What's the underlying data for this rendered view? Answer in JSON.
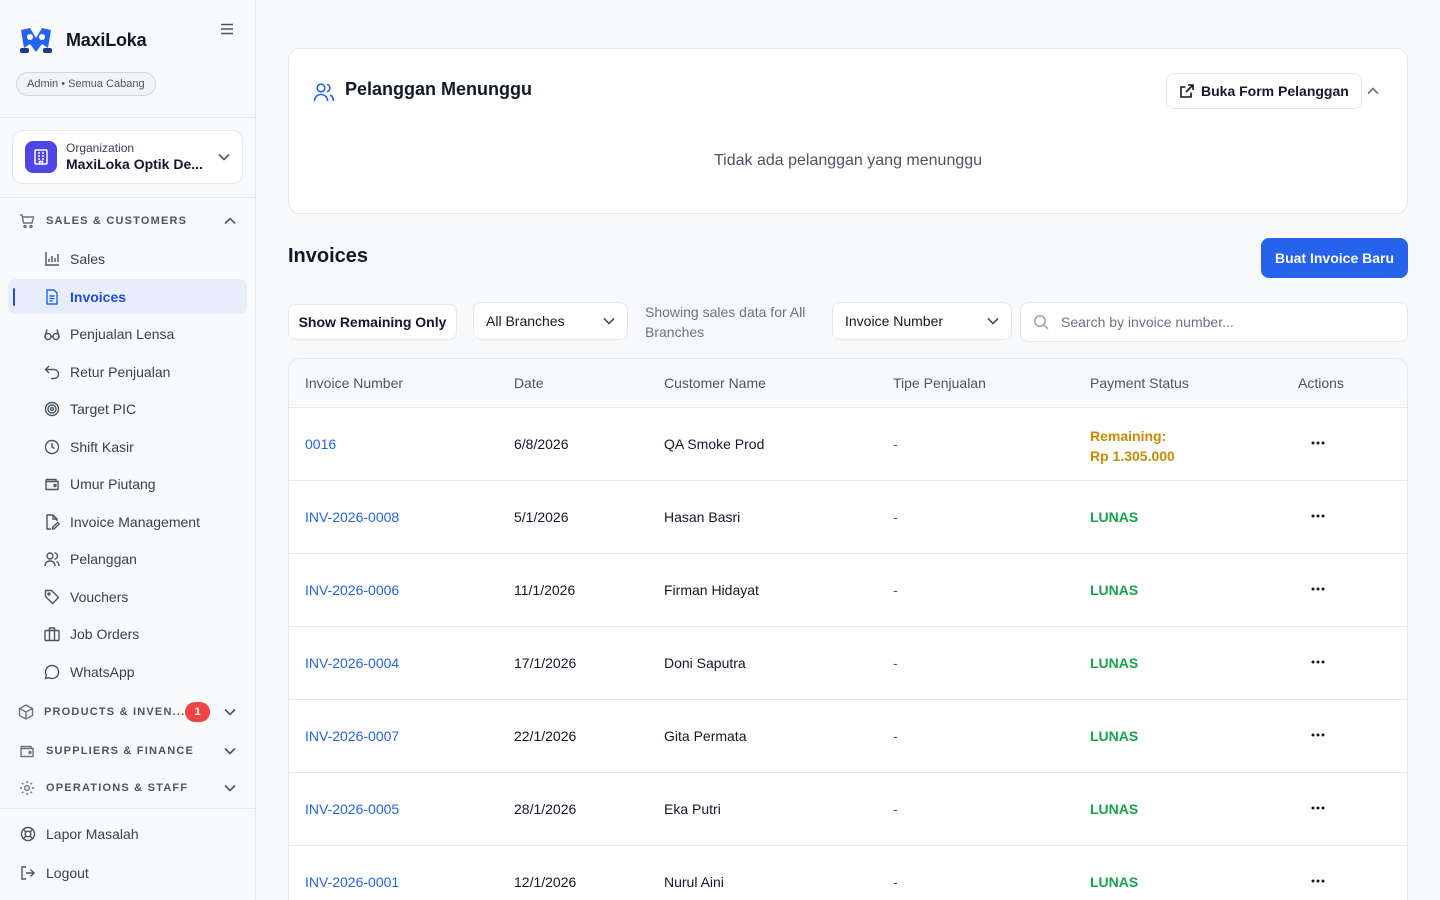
{
  "app": {
    "name": "MaxiLoka",
    "role": "Admin • Semua Cabang"
  },
  "org": {
    "label": "Organization",
    "name": "MaxiLoka Optik De..."
  },
  "sidebar": {
    "sections": [
      {
        "title": "SALES & CUSTOMERS",
        "icon": "cart-icon"
      },
      {
        "title": "PRODUCTS & INVEN...",
        "icon": "box-icon",
        "badge": "1"
      },
      {
        "title": "SUPPLIERS & FINANCE",
        "icon": "wallet-icon"
      },
      {
        "title": "OPERATIONS & STAFF",
        "icon": "gear-icon"
      }
    ],
    "items": [
      {
        "label": "Sales",
        "icon": "bar-chart-icon"
      },
      {
        "label": "Invoices",
        "icon": "document-icon",
        "active": true
      },
      {
        "label": "Penjualan Lensa",
        "icon": "glasses-icon"
      },
      {
        "label": "Retur Penjualan",
        "icon": "undo-icon"
      },
      {
        "label": "Target PIC",
        "icon": "target-icon"
      },
      {
        "label": "Shift Kasir",
        "icon": "clock-icon"
      },
      {
        "label": "Umur Piutang",
        "icon": "wallet-icon"
      },
      {
        "label": "Invoice Management",
        "icon": "file-edit-icon"
      },
      {
        "label": "Pelanggan",
        "icon": "users-icon"
      },
      {
        "label": "Vouchers",
        "icon": "tag-icon"
      },
      {
        "label": "Job Orders",
        "icon": "briefcase-icon"
      },
      {
        "label": "WhatsApp",
        "icon": "chat-icon"
      }
    ],
    "footer": [
      {
        "label": "Lapor Masalah",
        "icon": "lifebuoy-icon"
      },
      {
        "label": "Logout",
        "icon": "logout-icon"
      }
    ]
  },
  "waiting": {
    "title": "Pelanggan Menunggu",
    "form_button": "Buka Form Pelanggan",
    "empty_text": "Tidak ada pelanggan yang menunggu"
  },
  "invoices": {
    "title": "Invoices",
    "new_button": "Buat Invoice Baru",
    "filter_button": "Show Remaining Only",
    "branch_select": "All Branches",
    "showing_text": "Showing sales data for All Branches",
    "search_field_select": "Invoice Number",
    "search_placeholder": "Search by invoice number...",
    "columns": [
      "Invoice Number",
      "Date",
      "Customer Name",
      "Tipe Penjualan",
      "Payment Status",
      "Actions"
    ],
    "rows": [
      {
        "number": "0016",
        "date": "6/8/2026",
        "customer": "QA Smoke Prod",
        "type": "-",
        "status": "Remaining:",
        "amount": "Rp 1.305.000",
        "status_kind": "remaining"
      },
      {
        "number": "INV-2026-0008",
        "date": "5/1/2026",
        "customer": "Hasan Basri",
        "type": "-",
        "status": "LUNAS",
        "status_kind": "paid"
      },
      {
        "number": "INV-2026-0006",
        "date": "11/1/2026",
        "customer": "Firman Hidayat",
        "type": "-",
        "status": "LUNAS",
        "status_kind": "paid"
      },
      {
        "number": "INV-2026-0004",
        "date": "17/1/2026",
        "customer": "Doni Saputra",
        "type": "-",
        "status": "LUNAS",
        "status_kind": "paid"
      },
      {
        "number": "INV-2026-0007",
        "date": "22/1/2026",
        "customer": "Gita Permata",
        "type": "-",
        "status": "LUNAS",
        "status_kind": "paid"
      },
      {
        "number": "INV-2026-0005",
        "date": "28/1/2026",
        "customer": "Eka Putri",
        "type": "-",
        "status": "LUNAS",
        "status_kind": "paid"
      },
      {
        "number": "INV-2026-0001",
        "date": "12/1/2026",
        "customer": "Nurul Aini",
        "type": "-",
        "status": "LUNAS",
        "status_kind": "paid"
      }
    ]
  },
  "colors": {
    "accent": "#2563eb",
    "paid": "#16a34a",
    "remaining": "#ca8a04",
    "badge": "#ef4444",
    "org_icon": "#4f46e5"
  }
}
